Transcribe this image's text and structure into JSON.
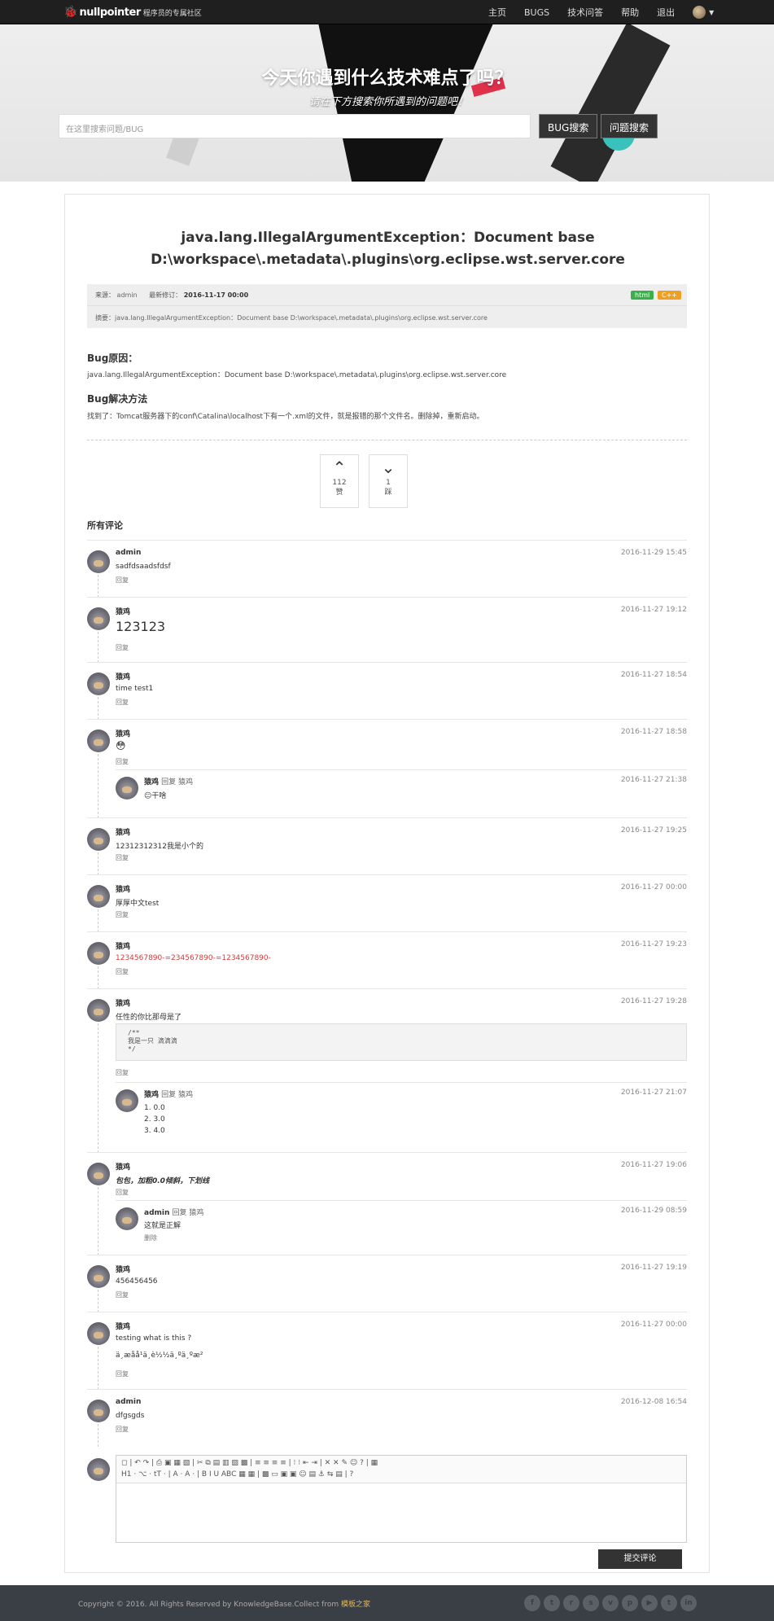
{
  "nav": {
    "brand": "nullpointer",
    "tagline": "程序员的专属社区",
    "links": [
      "主页",
      "BUGS",
      "技术问答",
      "帮助",
      "退出"
    ]
  },
  "hero": {
    "title": "今天你遇到什么技术难点了吗？",
    "subtitle": "请在下方搜索你所遇到的问题吧！",
    "search_placeholder": "在这里搜索问题/BUG",
    "bug_search": "BUG搜索",
    "question_search": "问题搜索"
  },
  "article": {
    "title_line1": "java.lang.IllegalArgumentException：Document base",
    "title_line2": "D:\\workspace\\.metadata\\.plugins\\org.eclipse.wst.server.core",
    "source_label": "来源：",
    "source": "admin",
    "modified_label": "最新修订：",
    "modified": "2016-11-17 00:00",
    "tags": [
      "html",
      "C++"
    ],
    "summary_label": "摘要：",
    "summary": "java.lang.IllegalArgumentException：Document base D:\\workspace\\.metadata\\.plugins\\org.eclipse.wst.server.core",
    "cause_heading": "Bug原因：",
    "cause": "java.lang.IllegalArgumentException：Document base D:\\workspace\\.metadata\\.plugins\\org.eclipse.wst.server.core",
    "solution_heading": "Bug解决方法",
    "solution": "找到了：Tomcat服务器下的conf\\Catalina\\localhost下有一个.xml的文件，就是报错的那个文件名。删除掉，重新启动。"
  },
  "votes": {
    "up_count": "112",
    "up_label": "赞",
    "down_count": "1",
    "down_label": "踩"
  },
  "comments_heading": "所有评论",
  "reply_label": "回复",
  "delete_label": "删除",
  "comments": [
    {
      "name": "admin",
      "date": "2016-11-29 15:45",
      "body": "sadfdsaadsfdsf"
    },
    {
      "name": "猿鸡",
      "date": "2016-11-27 19:12",
      "body": "123123"
    },
    {
      "name": "猿鸡",
      "date": "2016-11-27 18:54",
      "body": "time test1"
    },
    {
      "name": "猿鸡",
      "date": "2016-11-27 18:58",
      "body": "😳"
    },
    {
      "name": "猿鸡",
      "date": "2016-11-27 19:25",
      "body": "12312312312我是小个的"
    },
    {
      "name": "猿鸡",
      "date": "2016-11-27 00:00",
      "body": "厚厚中文test"
    },
    {
      "name": "猿鸡",
      "date": "2016-11-27 19:23",
      "body": "1234567890-=234567890-=1234567890-"
    },
    {
      "name": "猿鸡",
      "date": "2016-11-27 19:28",
      "body": "任性的你比那母是了"
    },
    {
      "name": "猿鸡",
      "date": "2016-11-27 19:06",
      "body": "包包，加粗0.0倾斜，下划线"
    },
    {
      "name": "猿鸡",
      "date": "2016-11-27 19:19",
      "body": "456456456"
    },
    {
      "name": "猿鸡",
      "date": "2016-11-27 00:00",
      "body": "testing what is this ?",
      "body2": "ä¸­æåå­¹ä¸è½½ä¸ºä¸ºæ²"
    },
    {
      "name": "admin",
      "date": "2016-12-08 16:54",
      "body": "dfgsgds"
    }
  ],
  "replies": [
    {
      "name": "猿鸡",
      "to": "回复 猿鸡",
      "date": "2016-11-27 21:38",
      "body": "😐干啥"
    },
    {
      "name": "猿鸡",
      "to": "回复 猿鸡",
      "date": "2016-11-27 21:07",
      "list": [
        "0.0",
        "3.0",
        "4.0"
      ]
    },
    {
      "name": "admin",
      "to": "回复 猿鸡",
      "date": "2016-11-29 08:59",
      "body": "这就是正解"
    }
  ],
  "code_block": [
    "/**",
    "我是一只 滴滴滴",
    "*/"
  ],
  "editor": {
    "row1": "◻ | ↶ ↷ | ⎙ ▣ ▦ ▧ | ✂ ⧉ ▤ ▥ ▨ ▩ | ≡ ≡ ≡ ≡ | ⁝ ⁝ ⇤ ⇥ | ✕ ✕ ✎ ☺ ? | ▦",
    "row2": "H1 · ⌥ · tT · | A · A · | B I U ABC ▦ ▦ | ▩ ▭ ▣ ▣ ☺ ▤ ⚓ ⇆ ▤ | ?",
    "submit": "提交评论"
  },
  "footer": {
    "copyright": "Copyright © 2016. All Rights Reserved by KnowledgeBase.Collect from ",
    "highlight": "模板之家",
    "social": [
      "f",
      "t",
      "r",
      "s",
      "v",
      "p",
      "▶",
      "t",
      "in"
    ]
  }
}
